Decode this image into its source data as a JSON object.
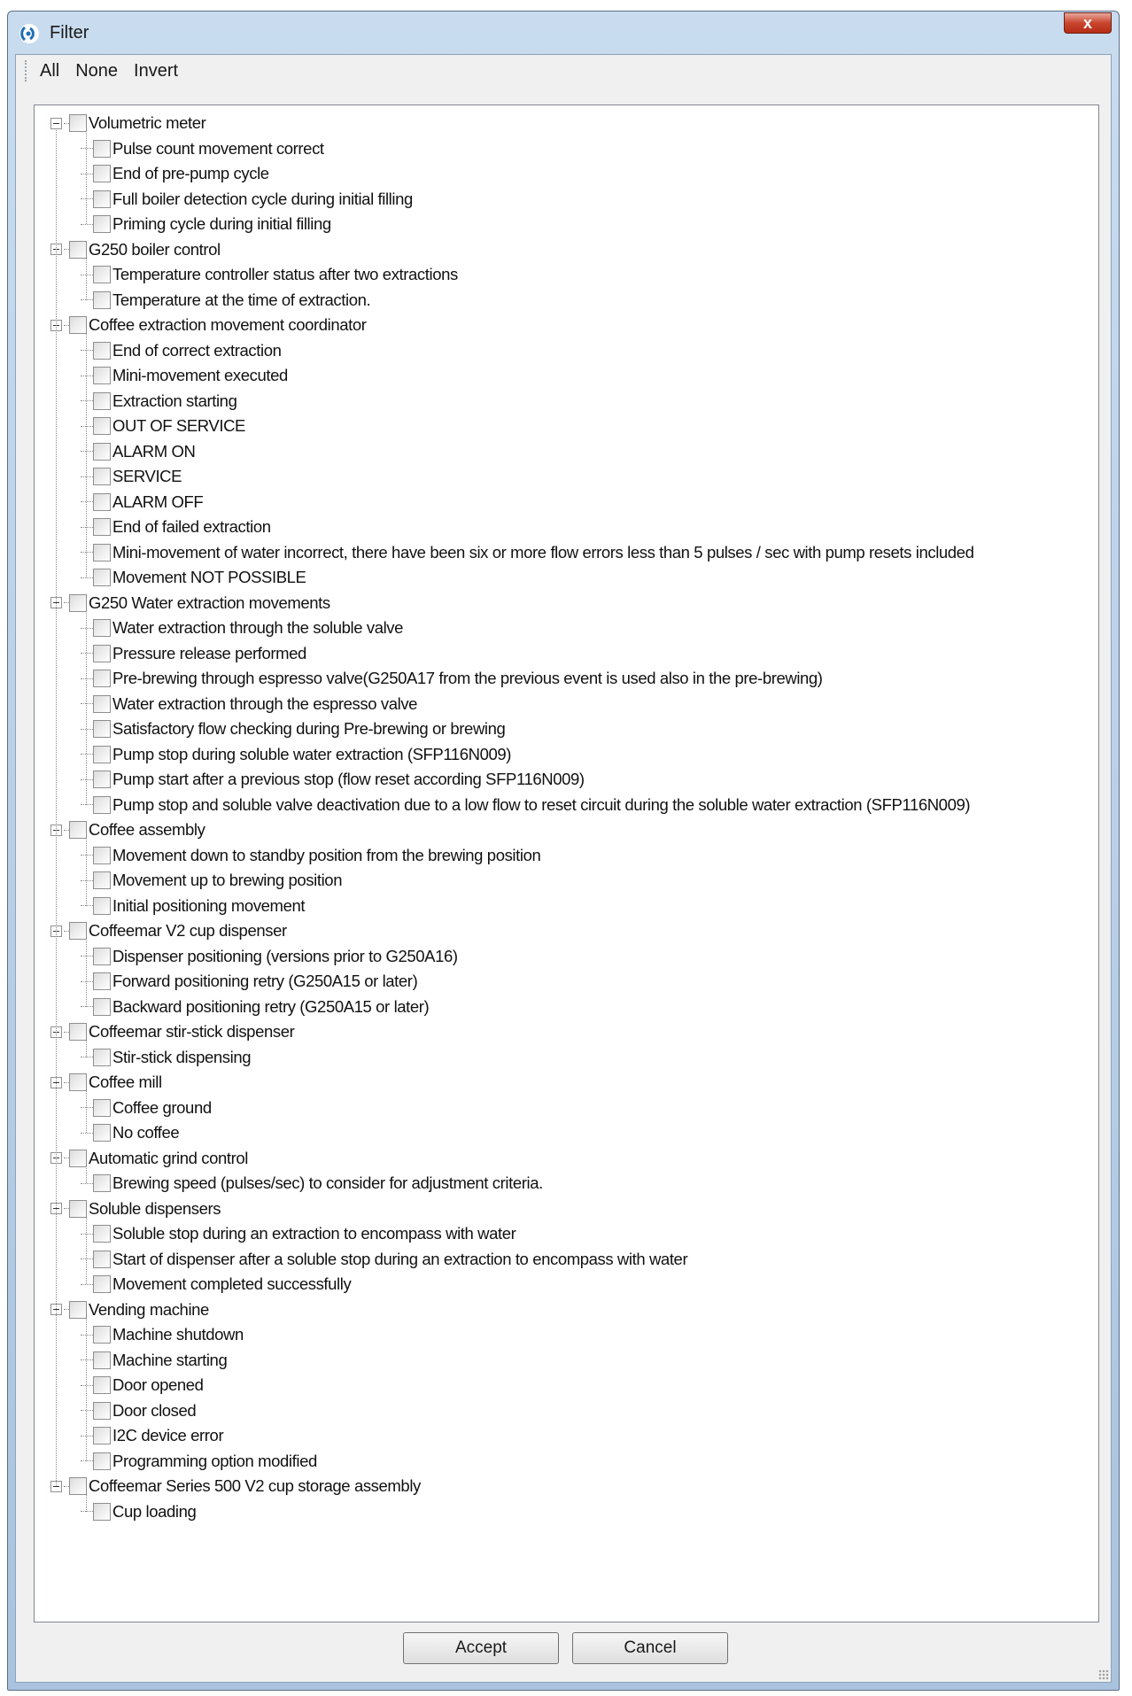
{
  "window": {
    "title": "Filter",
    "close_label": "x"
  },
  "toolbar": {
    "all_label": "All",
    "none_label": "None",
    "invert_label": "Invert"
  },
  "tree": [
    {
      "label": "Volumetric meter",
      "children": [
        "Pulse count movement correct",
        "End of pre-pump cycle",
        "Full boiler detection cycle during initial filling",
        "Priming cycle during initial filling"
      ]
    },
    {
      "label": "G250 boiler control",
      "children": [
        "Temperature controller status after two extractions",
        "Temperature at the time of extraction."
      ]
    },
    {
      "label": "Coffee extraction movement coordinator",
      "children": [
        "End of correct extraction",
        "Mini-movement executed",
        "Extraction starting",
        "OUT OF SERVICE",
        "ALARM ON",
        "SERVICE",
        "ALARM OFF",
        "End of failed extraction",
        "Mini-movement of water incorrect, there have been six or more flow errors less than 5 pulses / sec with  pump resets included",
        "Movement NOT POSSIBLE"
      ]
    },
    {
      "label": "G250 Water extraction movements",
      "children": [
        "Water extraction through the soluble valve",
        "Pressure release performed",
        "Pre-brewing through espresso valve(G250A17 from the previous event is used also in the pre-brewing)",
        "Water extraction through the espresso valve",
        "Satisfactory flow checking during Pre-brewing or brewing",
        "Pump stop during soluble water extraction (SFP116N009)",
        "Pump start after a previous stop (flow reset according SFP116N009)",
        "Pump stop and soluble valve deactivation due to a low flow to reset circuit during the soluble water extraction (SFP116N009)"
      ]
    },
    {
      "label": "Coffee assembly",
      "children": [
        "Movement down to standby position from the brewing position",
        "Movement up to brewing position",
        "Initial positioning movement"
      ]
    },
    {
      "label": "Coffeemar V2 cup dispenser",
      "children": [
        "Dispenser positioning (versions prior to G250A16)",
        "Forward positioning retry (G250A15 or later)",
        "Backward positioning retry (G250A15 or later)"
      ]
    },
    {
      "label": "Coffeemar stir-stick dispenser",
      "children": [
        "Stir-stick dispensing"
      ]
    },
    {
      "label": "Coffee mill",
      "children": [
        "Coffee ground",
        "No coffee"
      ]
    },
    {
      "label": "Automatic grind control",
      "children": [
        "Brewing speed (pulses/sec) to consider for adjustment criteria."
      ]
    },
    {
      "label": "Soluble dispensers",
      "children": [
        "Soluble stop during an extraction to encompass with water",
        "Start of dispenser after a soluble stop during an extraction to encompass with water",
        "Movement completed successfully"
      ]
    },
    {
      "label": "Vending machine",
      "children": [
        "Machine shutdown",
        "Machine starting",
        "Door opened",
        "Door closed",
        "I2C device error",
        "Programming option modified"
      ]
    },
    {
      "label": "Coffeemar Series 500 V2 cup storage assembly",
      "children": [
        "Cup loading"
      ]
    }
  ],
  "buttons": {
    "accept_label": "Accept",
    "cancel_label": "Cancel"
  }
}
